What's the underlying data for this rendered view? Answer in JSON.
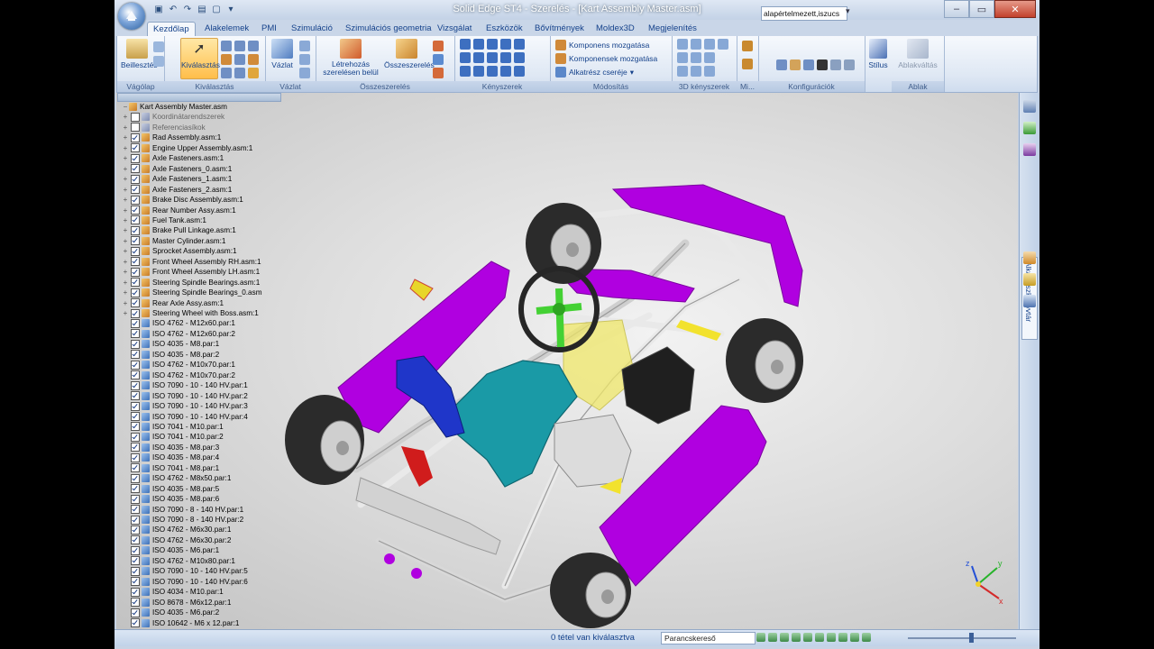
{
  "window": {
    "title": "Solid Edge ST4 - Szerelés - [Kart Assembly Master.asm]"
  },
  "qat_icons": [
    "save-icon",
    "undo-icon",
    "redo-icon",
    "print-icon",
    "new-icon"
  ],
  "tabs": [
    "Kezdőlap",
    "Alakelemek",
    "PMI",
    "Szimuláció",
    "Szimulációs geometria",
    "Vizsgálat",
    "Eszközök",
    "Bővítmények",
    "Moldex3D",
    "Megjelenítés"
  ],
  "ribbon": {
    "paste_label": "Beillesztés",
    "select_label": "Kiválasztás",
    "sketch_label": "Vázlat",
    "create_in_place_label": "Létrehozás szerelésen belül",
    "assemble_label": "Összeszerelés",
    "move_component_label": "Komponens mozgatása",
    "move_components_label": "Komponensek mozgatása",
    "replace_part_label": "Alkatrész cseréje",
    "config_value": "alapértelmezett,iszucs",
    "style_label": "Stílus",
    "window_switch_label": "Ablakváltás",
    "groups": {
      "clipboard": "Vágólap",
      "select": "Kiválasztás",
      "sketch": "Vázlat",
      "assemble": "Összeszerelés",
      "constraints": "Kényszerek",
      "modify": "Módosítás",
      "constraints3d": "3D kényszerek",
      "misc": "Mi...",
      "config": "Konfigurációk",
      "window": "Ablak"
    }
  },
  "tree": {
    "root": "Kart Assembly Master.asm",
    "items": [
      {
        "label": "Koordinátarendszerek",
        "type": "cs",
        "checked": false,
        "expand": true
      },
      {
        "label": "Referenciasíkok",
        "type": "cs",
        "checked": false,
        "expand": true
      },
      {
        "label": "Rad Assembly.asm:1",
        "type": "asm",
        "checked": true,
        "expand": true
      },
      {
        "label": "Engine Upper Assembly.asm:1",
        "type": "asm",
        "checked": true,
        "expand": true
      },
      {
        "label": "Axle Fasteners.asm:1",
        "type": "asm",
        "checked": true,
        "expand": true
      },
      {
        "label": "Axle Fasteners_0.asm:1",
        "type": "asm",
        "checked": true,
        "expand": true
      },
      {
        "label": "Axle Fasteners_1.asm:1",
        "type": "asm",
        "checked": true,
        "expand": true
      },
      {
        "label": "Axle Fasteners_2.asm:1",
        "type": "asm",
        "checked": true,
        "expand": true
      },
      {
        "label": "Brake Disc Assembly.asm:1",
        "type": "asm",
        "checked": true,
        "expand": true
      },
      {
        "label": "Rear Number Assy.asm:1",
        "type": "asm",
        "checked": true,
        "expand": true
      },
      {
        "label": "Fuel Tank.asm:1",
        "type": "asm",
        "checked": true,
        "expand": true
      },
      {
        "label": "Brake Pull Linkage.asm:1",
        "type": "asm",
        "checked": true,
        "expand": true
      },
      {
        "label": "Master Cylinder.asm:1",
        "type": "asm",
        "checked": true,
        "expand": true
      },
      {
        "label": "Sprocket Assembly.asm:1",
        "type": "asm",
        "checked": true,
        "expand": true
      },
      {
        "label": "Front Wheel Assembly RH.asm:1",
        "type": "asm",
        "checked": true,
        "expand": true
      },
      {
        "label": "Front Wheel Assembly LH.asm:1",
        "type": "asm",
        "checked": true,
        "expand": true
      },
      {
        "label": "Steering Spindle Bearings.asm:1",
        "type": "asm",
        "checked": true,
        "expand": true
      },
      {
        "label": "Steering Spindle Bearings_0.asm",
        "type": "asm",
        "checked": true,
        "expand": true
      },
      {
        "label": "Rear Axle Assy.asm:1",
        "type": "asm",
        "checked": true,
        "expand": true
      },
      {
        "label": "Steering Wheel with Boss.asm:1",
        "type": "asm",
        "checked": true,
        "expand": true
      },
      {
        "label": "ISO 4762 - M12x60.par:1",
        "type": "par",
        "checked": true,
        "expand": false
      },
      {
        "label": "ISO 4762 - M12x60.par:2",
        "type": "par",
        "checked": true,
        "expand": false
      },
      {
        "label": "ISO 4035 - M8.par:1",
        "type": "par",
        "checked": true,
        "expand": false
      },
      {
        "label": "ISO 4035 - M8.par:2",
        "type": "par",
        "checked": true,
        "expand": false
      },
      {
        "label": "ISO 4762 - M10x70.par:1",
        "type": "par",
        "checked": true,
        "expand": false
      },
      {
        "label": "ISO 4762 - M10x70.par:2",
        "type": "par",
        "checked": true,
        "expand": false
      },
      {
        "label": "ISO 7090 - 10 - 140 HV.par:1",
        "type": "par",
        "checked": true,
        "expand": false
      },
      {
        "label": "ISO 7090 - 10 - 140 HV.par:2",
        "type": "par",
        "checked": true,
        "expand": false
      },
      {
        "label": "ISO 7090 - 10 - 140 HV.par:3",
        "type": "par",
        "checked": true,
        "expand": false
      },
      {
        "label": "ISO 7090 - 10 - 140 HV.par:4",
        "type": "par",
        "checked": true,
        "expand": false
      },
      {
        "label": "ISO 7041 - M10.par:1",
        "type": "par",
        "checked": true,
        "expand": false
      },
      {
        "label": "ISO 7041 - M10.par:2",
        "type": "par",
        "checked": true,
        "expand": false
      },
      {
        "label": "ISO 4035 - M8.par:3",
        "type": "par",
        "checked": true,
        "expand": false
      },
      {
        "label": "ISO 4035 - M8.par:4",
        "type": "par",
        "checked": true,
        "expand": false
      },
      {
        "label": "ISO 7041 - M8.par:1",
        "type": "par",
        "checked": true,
        "expand": false
      },
      {
        "label": "ISO 4762 - M8x50.par:1",
        "type": "par",
        "checked": true,
        "expand": false
      },
      {
        "label": "ISO 4035 - M8.par:5",
        "type": "par",
        "checked": true,
        "expand": false
      },
      {
        "label": "ISO 4035 - M8.par:6",
        "type": "par",
        "checked": true,
        "expand": false
      },
      {
        "label": "ISO 7090 - 8 - 140 HV.par:1",
        "type": "par",
        "checked": true,
        "expand": false
      },
      {
        "label": "ISO 7090 - 8 - 140 HV.par:2",
        "type": "par",
        "checked": true,
        "expand": false
      },
      {
        "label": "ISO 4762 - M6x30.par:1",
        "type": "par",
        "checked": true,
        "expand": false
      },
      {
        "label": "ISO 4762 - M6x30.par:2",
        "type": "par",
        "checked": true,
        "expand": false
      },
      {
        "label": "ISO 4035 - M6.par:1",
        "type": "par",
        "checked": true,
        "expand": false
      },
      {
        "label": "ISO 4762 - M10x80.par:1",
        "type": "par",
        "checked": true,
        "expand": false
      },
      {
        "label": "ISO 7090 - 10 - 140 HV.par:5",
        "type": "par",
        "checked": true,
        "expand": false
      },
      {
        "label": "ISO 7090 - 10 - 140 HV.par:6",
        "type": "par",
        "checked": true,
        "expand": false
      },
      {
        "label": "ISO 4034 - M10.par:1",
        "type": "par",
        "checked": true,
        "expand": false
      },
      {
        "label": "ISO 8678 - M6x12.par:1",
        "type": "par",
        "checked": true,
        "expand": false
      },
      {
        "label": "ISO 4035 - M6.par:2",
        "type": "par",
        "checked": true,
        "expand": false
      },
      {
        "label": "ISO 10642 - M6 x 12.par:1",
        "type": "par",
        "checked": true,
        "expand": false
      }
    ]
  },
  "side_panel": {
    "tab_label": "Alkatrészkönyvtár"
  },
  "triad": {
    "x": "x",
    "y": "y",
    "z": "z"
  },
  "status": {
    "selection": "0 tétel van kiválasztva",
    "command_search": "Parancskereső"
  },
  "colors": {
    "accent": "#15428b",
    "kart_body": "#b000e0",
    "seat": "#1a9aa6"
  }
}
